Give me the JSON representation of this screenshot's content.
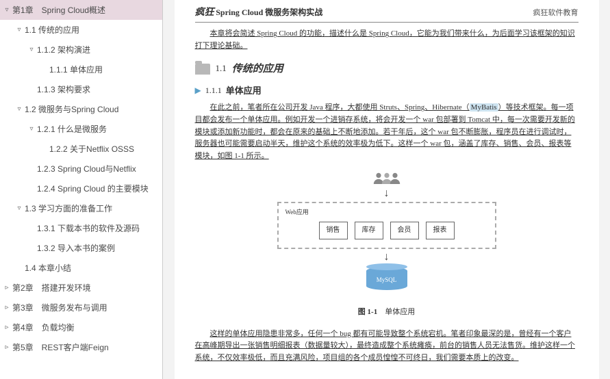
{
  "sidebar": {
    "items": [
      {
        "label": "第1章　Spring Cloud概述",
        "indent": 0,
        "arrow": "▿",
        "selected": true
      },
      {
        "label": "1.1 传统的应用",
        "indent": 1,
        "arrow": "▿"
      },
      {
        "label": "1.1.2 架构演进",
        "indent": 2,
        "arrow": "▿"
      },
      {
        "label": "1.1.1 单体应用",
        "indent": 3,
        "arrow": ""
      },
      {
        "label": "1.1.3 架构要求",
        "indent": 2,
        "arrow": ""
      },
      {
        "label": "1.2 微服务与Spring Cloud",
        "indent": 1,
        "arrow": "▿"
      },
      {
        "label": "1.2.1 什么是微服务",
        "indent": 2,
        "arrow": "▿"
      },
      {
        "label": "1.2.2 关于Netflix OSSS",
        "indent": 3,
        "arrow": ""
      },
      {
        "label": "1.2.3 Spring Cloud与Netflix",
        "indent": 2,
        "arrow": ""
      },
      {
        "label": "1.2.4 Spring Cloud 的主要模块",
        "indent": 2,
        "arrow": ""
      },
      {
        "label": "1.3 学习方面的准备工作",
        "indent": 1,
        "arrow": "▿"
      },
      {
        "label": "1.3.1 下载本书的软件及源码",
        "indent": 2,
        "arrow": ""
      },
      {
        "label": "1.3.2 导入本书的案例",
        "indent": 2,
        "arrow": ""
      },
      {
        "label": "1.4 本章小结",
        "indent": 1,
        "arrow": ""
      },
      {
        "label": "第2章　搭建开发环境",
        "indent": 0,
        "arrow": "▹"
      },
      {
        "label": "第3章　微服务发布与调用",
        "indent": 0,
        "arrow": "▹"
      },
      {
        "label": "第4章　负载均衡",
        "indent": 0,
        "arrow": "▹"
      },
      {
        "label": "第5章　REST客户端Feign",
        "indent": 0,
        "arrow": "▹"
      }
    ]
  },
  "doc": {
    "brand_prefix": "疯狂",
    "brand_title": "Spring Cloud 微服务架构实战",
    "right_head": "疯狂软件教育",
    "intro": "本章将会简述 Spring Cloud 的功能，描述什么是 Spring Cloud，它能为我们带来什么，为后面学习该框架的知识打下理论基础。",
    "sec_num": "1.1",
    "sec_title": "传统的应用",
    "subsec_num": "1.1.1",
    "subsec_title": "单体应用",
    "p1a": "在此之前，笔者所在公司开发 Java 程序，大都使用 Struts、Spring、Hibernate（",
    "p1_hi": "MyBatis",
    "p1b": "）等技术框架。每一项目都会发布一个单体应用。例如开发一个进销存系统，将会开发一个 war 包部署到 Tomcat 中，每一次需要开发新的模块或添加新功能时，都会在原来的基础上不断地添加。若干年后，这个 war 包不断膨胀，程序员在进行调试时，服务器也可能需要启动半天，维护这个系统的效率极为低下。这样一个 war 包，涵盖了库存、销售、会员、报表等模块，如图 1-1 所示。",
    "web_label": "Web应用",
    "modules": [
      "销售",
      "库存",
      "会员",
      "报表"
    ],
    "db_label": "MySQL",
    "fig_num": "图 1-1",
    "fig_title": "单体应用",
    "p2": "这样的单体应用隐患非常多，任何一个 bug 都有可能导致整个系统宕机。笔者印象最深的是，曾经有一个客户在高峰期导出一张销售明细报表（数据量较大），最终造成整个系统瘫痪，前台的销售人员无法售货。维护这样一个系统，不仅效率极低，而且充满风险，项目组的各个成员惶惶不可终日，我们需要本质上的改变。"
  }
}
